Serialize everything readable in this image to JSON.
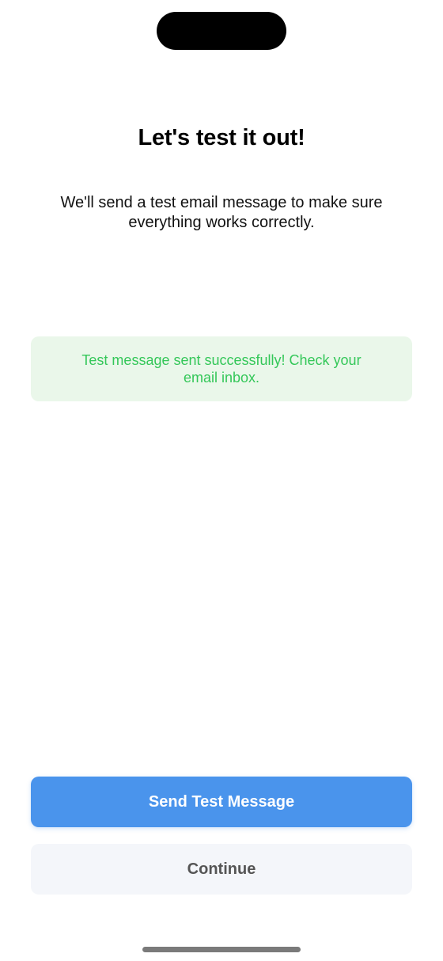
{
  "screen": {
    "title": "Let's test it out!",
    "description": "We'll send a test email message to make sure everything works correctly."
  },
  "status": {
    "message": "Test message sent successfully! Check your email inbox.",
    "text_color": "#34c759",
    "background_color": "#eaf7ea"
  },
  "actions": {
    "send_test_label": "Send Test Message",
    "continue_label": "Continue",
    "primary_color": "#4a94ec"
  }
}
